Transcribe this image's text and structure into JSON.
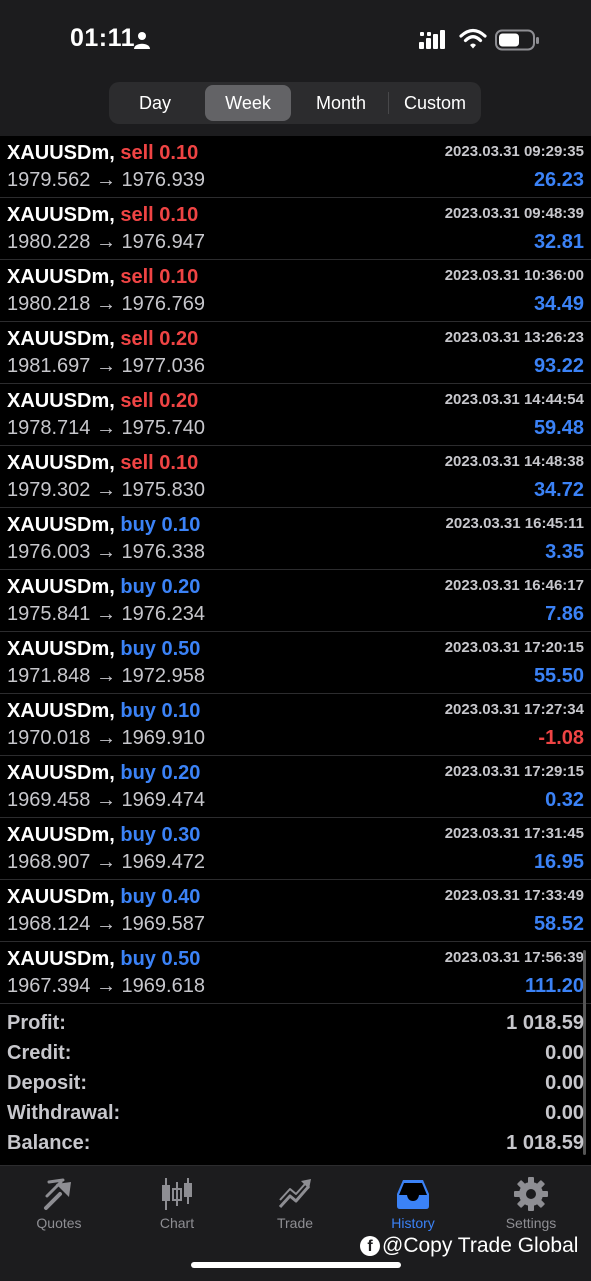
{
  "status": {
    "time": "01:11"
  },
  "segments": [
    {
      "label": "Day",
      "active": false
    },
    {
      "label": "Week",
      "active": true
    },
    {
      "label": "Month",
      "active": false
    },
    {
      "label": "Custom",
      "active": false
    }
  ],
  "trades": [
    {
      "symbol": "XAUUSDm,",
      "side": "sell",
      "volume": "0.10",
      "datetime": "2023.03.31 09:29:35",
      "prices": "1979.562 → 1976.939",
      "profit": "26.23"
    },
    {
      "symbol": "XAUUSDm,",
      "side": "sell",
      "volume": "0.10",
      "datetime": "2023.03.31 09:48:39",
      "prices": "1980.228 → 1976.947",
      "profit": "32.81"
    },
    {
      "symbol": "XAUUSDm,",
      "side": "sell",
      "volume": "0.10",
      "datetime": "2023.03.31 10:36:00",
      "prices": "1980.218 → 1976.769",
      "profit": "34.49"
    },
    {
      "symbol": "XAUUSDm,",
      "side": "sell",
      "volume": "0.20",
      "datetime": "2023.03.31 13:26:23",
      "prices": "1981.697 → 1977.036",
      "profit": "93.22"
    },
    {
      "symbol": "XAUUSDm,",
      "side": "sell",
      "volume": "0.20",
      "datetime": "2023.03.31 14:44:54",
      "prices": "1978.714 → 1975.740",
      "profit": "59.48"
    },
    {
      "symbol": "XAUUSDm,",
      "side": "sell",
      "volume": "0.10",
      "datetime": "2023.03.31 14:48:38",
      "prices": "1979.302 → 1975.830",
      "profit": "34.72"
    },
    {
      "symbol": "XAUUSDm,",
      "side": "buy",
      "volume": "0.10",
      "datetime": "2023.03.31 16:45:11",
      "prices": "1976.003 → 1976.338",
      "profit": "3.35"
    },
    {
      "symbol": "XAUUSDm,",
      "side": "buy",
      "volume": "0.20",
      "datetime": "2023.03.31 16:46:17",
      "prices": "1975.841 → 1976.234",
      "profit": "7.86"
    },
    {
      "symbol": "XAUUSDm,",
      "side": "buy",
      "volume": "0.50",
      "datetime": "2023.03.31 17:20:15",
      "prices": "1971.848 → 1972.958",
      "profit": "55.50"
    },
    {
      "symbol": "XAUUSDm,",
      "side": "buy",
      "volume": "0.10",
      "datetime": "2023.03.31 17:27:34",
      "prices": "1970.018 → 1969.910",
      "profit": "-1.08"
    },
    {
      "symbol": "XAUUSDm,",
      "side": "buy",
      "volume": "0.20",
      "datetime": "2023.03.31 17:29:15",
      "prices": "1969.458 → 1969.474",
      "profit": "0.32"
    },
    {
      "symbol": "XAUUSDm,",
      "side": "buy",
      "volume": "0.30",
      "datetime": "2023.03.31 17:31:45",
      "prices": "1968.907 → 1969.472",
      "profit": "16.95"
    },
    {
      "symbol": "XAUUSDm,",
      "side": "buy",
      "volume": "0.40",
      "datetime": "2023.03.31 17:33:49",
      "prices": "1968.124 → 1969.587",
      "profit": "58.52"
    },
    {
      "symbol": "XAUUSDm,",
      "side": "buy",
      "volume": "0.50",
      "datetime": "2023.03.31 17:56:39",
      "prices": "1967.394 → 1969.618",
      "profit": "111.20"
    }
  ],
  "summary": [
    {
      "label": "Profit:",
      "value": "1 018.59"
    },
    {
      "label": "Credit:",
      "value": "0.00"
    },
    {
      "label": "Deposit:",
      "value": "0.00"
    },
    {
      "label": "Withdrawal:",
      "value": "0.00"
    },
    {
      "label": "Balance:",
      "value": "1 018.59"
    }
  ],
  "tabs": [
    {
      "label": "Quotes",
      "icon": "quotes-icon",
      "active": false
    },
    {
      "label": "Chart",
      "icon": "chart-icon",
      "active": false
    },
    {
      "label": "Trade",
      "icon": "trade-icon",
      "active": false
    },
    {
      "label": "History",
      "icon": "history-icon",
      "active": true
    },
    {
      "label": "Settings",
      "icon": "settings-icon",
      "active": false
    }
  ],
  "watermark": {
    "logo": "f",
    "text": "@Copy Trade Global"
  },
  "colors": {
    "sell": "#ef4444",
    "buy": "#3b82f6",
    "profit_positive": "#3b82f6",
    "profit_negative": "#ef4444",
    "active_tab": "#3b82f6"
  }
}
